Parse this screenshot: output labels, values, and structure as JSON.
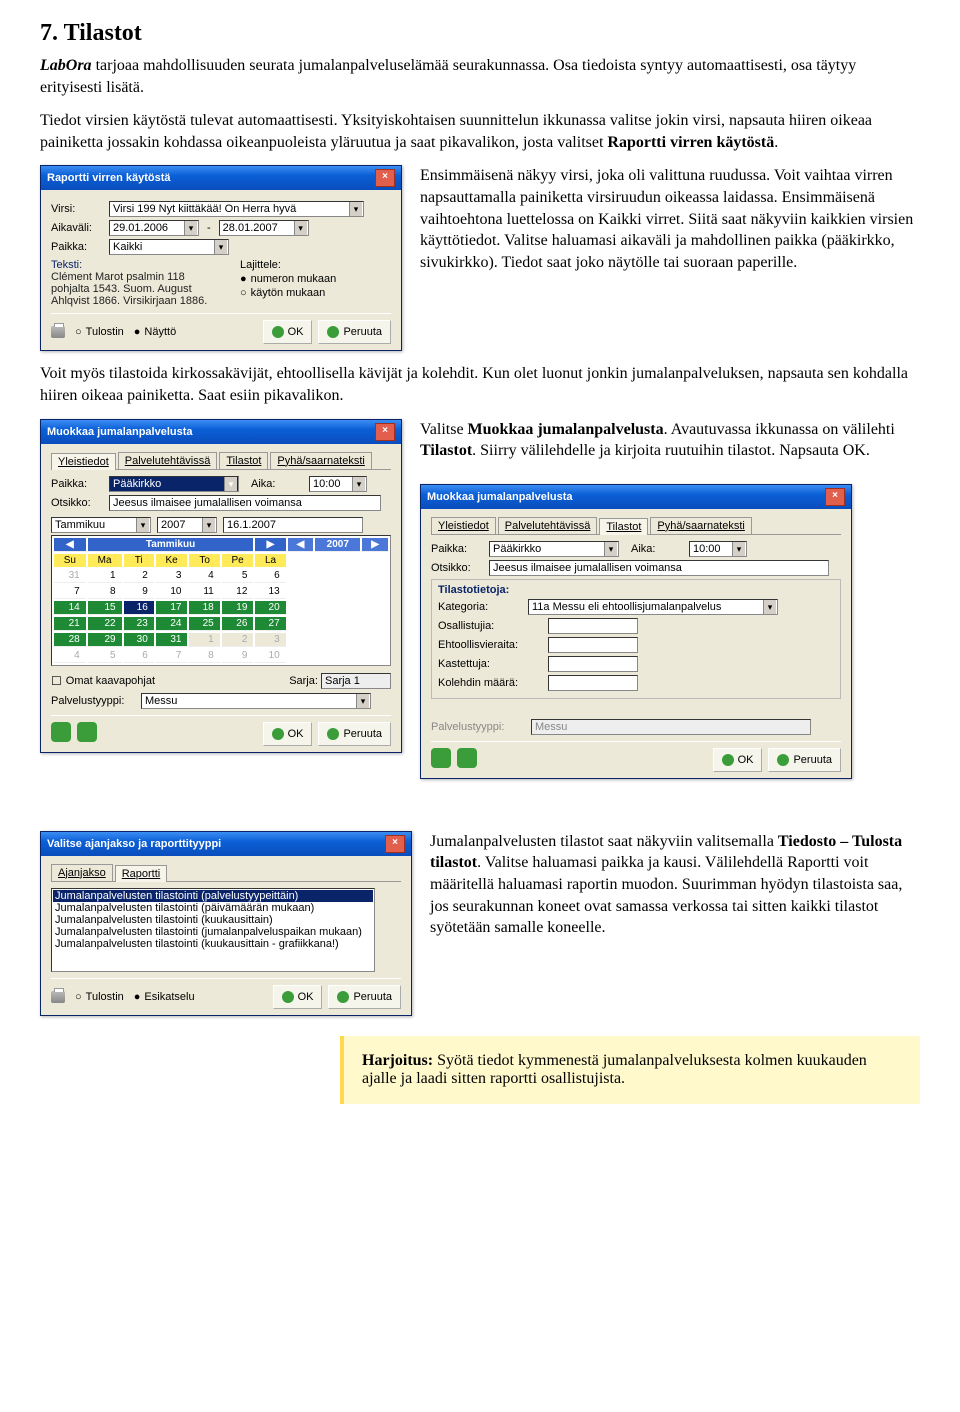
{
  "heading": "7. Tilastot",
  "intro_labora": "LabOra",
  "intro_rest": " tarjoaa mahdollisuuden seurata jumalanpalveluselämää seurakunnassa. Osa tiedoista syntyy automaattisesti, osa täytyy erityisesti lisätä.",
  "para2a": "Tiedot virsien käytöstä tulevat automaattisesti. Yksityiskohtaisen suunnittelun ikkunassa valitse jokin virsi, napsauta hiiren oikeaa painiketta jossakin kohdassa oikeanpuoleista yläruutua ja saat pikavalikon, josta valitset ",
  "para2b": "Raportti virren käytöstä",
  "para2c": ".",
  "aside1": "Ensimmäisenä näkyy virsi, joka oli valittuna ruudussa. Voit vaihtaa virren napsauttamalla painiketta virsiruudun oikeassa laidassa. Ensimmäisenä vaihtoehtona luettelossa on Kaikki virret. Siitä saat näkyviin kaikkien virsien käyttötiedot. Valitse haluamasi aikaväli ja mahdollinen paikka (pääkirkko, sivukirkko). Tiedot saat joko näytölle tai suoraan paperille.",
  "para3a": "Voit myös tilastoida kirkossakävijät, ehtoollisella kävijät ja kolehdit. Kun olet luonut jonkin jumalanpalveluksen, napsauta sen kohdalla hiiren oikeaa painiketta. Saat esiin pikavalikon.",
  "para3b": "Valitse ",
  "para3c": "Muokkaa jumalanpalvelusta",
  "para3d": ". Avautuvassa ikkunassa on välilehti ",
  "para3e": "Tilastot",
  "para3f": ". Siirry välilehdelle ja kirjoita ruutuihin tilastot. Napsauta OK.",
  "para4a": "Jumalanpalvelusten tilastot saat näkyviin valitsemalla ",
  "para4b": "Tiedosto – Tulosta tilastot",
  "para4c": ". Valitse haluamasi paikka ja kausi. Välilehdellä Raportti voit määritellä haluamasi raportin muodon. Suurimman hyödyn tilastoista saa, jos seurakunnan koneet ovat samassa verkossa tai sitten kaikki tilastot syötetään samalle koneelle.",
  "exercise_head": "Harjoitus:",
  "exercise_body": " Syötä tiedot kymmenestä jumalanpalveluksesta kolmen kuukauden ajalle ja laadi sitten raportti osallistujista.",
  "dlg1": {
    "title": "Raportti virren käytöstä",
    "labels": {
      "virsi": "Virsi:",
      "aikavali": "Aikaväli:",
      "paikka": "Paikka:",
      "teksti": "Teksti:",
      "lajittele": "Lajittele:",
      "tulostin": "Tulostin",
      "naytto": "Näyttö",
      "ok": "OK",
      "peruuta": "Peruuta"
    },
    "virsi_value": "Virsi 199  Nyt kiittäkää! On Herra hyvä",
    "date_from": "29.01.2006",
    "date_to": "28.01.2007",
    "paikka_value": "Kaikki",
    "teksti": "Clément Marot psalmin 118 pohjalta 1543. Suom. August Ahlqvist 1866. Virsikirjaan 1886.",
    "radio_numeron": "numeron mukaan",
    "radio_kayton": "käytön mukaan"
  },
  "dlg2": {
    "title": "Muokkaa jumalanpalvelusta",
    "tabs": [
      "Yleistiedot",
      "Palvelutehtävissä",
      "Tilastot",
      "Pyhä/saarnateksti"
    ],
    "paikka_lbl": "Paikka:",
    "paikka_val": "Pääkirkko",
    "aika_lbl": "Aika:",
    "aika_val": "10:00",
    "otsikko_lbl": "Otsikko:",
    "otsikko_val": "Jeesus ilmaisee jumalallisen voimansa",
    "month": "Tammikuu",
    "year": "2007",
    "datecap": "16.1.2007",
    "cal_head": [
      "Su",
      "Ma",
      "Ti",
      "Ke",
      "To",
      "Pe",
      "La"
    ],
    "rows": [
      [
        "31",
        "1",
        "2",
        "3",
        "4",
        "5",
        "6"
      ],
      [
        "7",
        "8",
        "9",
        "10",
        "11",
        "12",
        "13"
      ],
      [
        "14",
        "15",
        "16",
        "17",
        "18",
        "19",
        "20"
      ],
      [
        "21",
        "22",
        "23",
        "24",
        "25",
        "26",
        "27"
      ],
      [
        "28",
        "29",
        "30",
        "31",
        "1",
        "2",
        "3"
      ],
      [
        "4",
        "5",
        "6",
        "7",
        "8",
        "9",
        "10"
      ]
    ],
    "omat": "Omat kaavapohjat",
    "sarja_lbl": "Sarja:",
    "sarja_val": "Sarja 1",
    "pt_lbl": "Palvelustyyppi:",
    "pt_val": "Messu",
    "ok": "OK",
    "peruuta": "Peruuta"
  },
  "dlg3": {
    "title": "Muokkaa jumalanpalvelusta",
    "tabs": [
      "Yleistiedot",
      "Palvelutehtävissä",
      "Tilastot",
      "Pyhä/saarnateksti"
    ],
    "paikka_lbl": "Paikka:",
    "paikka_val": "Pääkirkko",
    "aika_lbl": "Aika:",
    "aika_val": "10:00",
    "otsikko_lbl": "Otsikko:",
    "otsikko_val": "Jeesus ilmaisee jumalallisen voimansa",
    "tilasto_cap": "Tilastotietoja:",
    "kat_lbl": "Kategoria:",
    "kat_val": "11a  Messu eli ehtoollisjumalanpalvelus",
    "f1": "Osallistujia:",
    "f2": "Ehtoollisvieraita:",
    "f3": "Kastettuja:",
    "f4": "Kolehdin määrä:",
    "pt_lbl": "Palvelustyyppi:",
    "pt_val": "Messu",
    "ok": "OK",
    "peruuta": "Peruuta"
  },
  "dlg4": {
    "title": "Valitse ajanjakso ja raporttityyppi",
    "tab_aj": "Ajanjakso",
    "tab_rap": "Raportti",
    "items": [
      "Jumalanpalvelusten tilastointi (palvelustyypeittäin)",
      "Jumalanpalvelusten tilastointi (päivämäärän mukaan)",
      "Jumalanpalvelusten tilastointi (kuukausittain)",
      "Jumalanpalvelusten tilastointi (jumalanpalveluspaikan mukaan)",
      "Jumalanpalvelusten tilastointi (kuukausittain - grafiikkana!)"
    ],
    "tulostin": "Tulostin",
    "esi": "Esikatselu",
    "ok": "OK",
    "peruuta": "Peruuta"
  }
}
